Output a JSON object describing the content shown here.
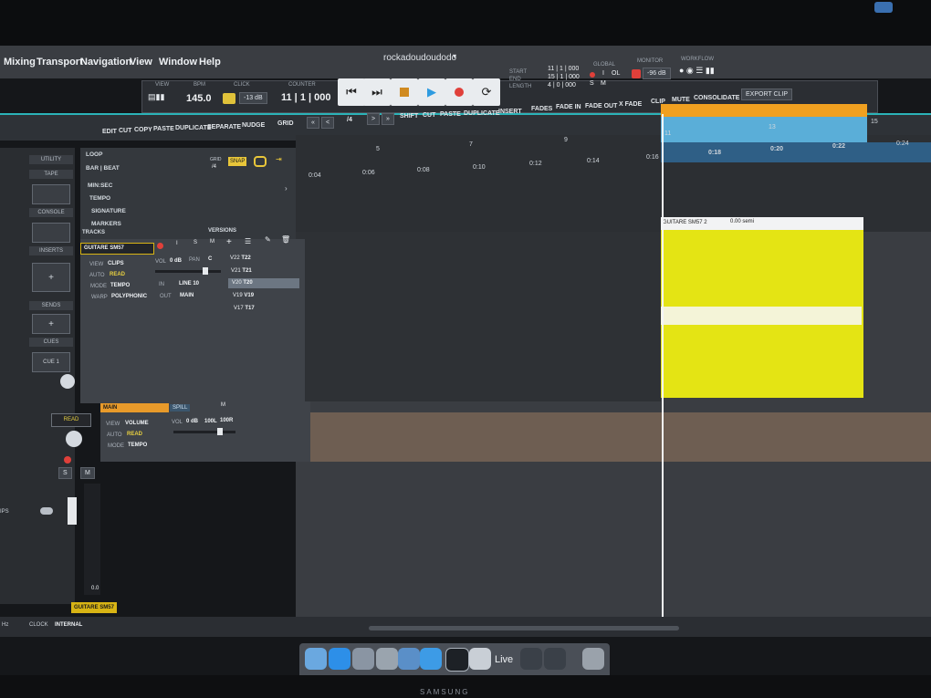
{
  "menu": {
    "items": [
      "Mixing",
      "Transport",
      "Navigation",
      "View",
      "Window",
      "Help"
    ]
  },
  "window": {
    "title": "rockadoudoudodo"
  },
  "transport": {
    "view_label": "VIEW",
    "bpm_label": "BPM",
    "bpm": "145.0",
    "click_label": "CLICK",
    "click_level": "-13 dB",
    "counter_label": "COUNTER",
    "counter": "11 | 1 | 000",
    "start_label": "START",
    "end_label": "END",
    "length_label": "LENGTH",
    "start": "11 | 1 | 000",
    "end": "15 | 1 | 000",
    "length": "4 | 0 | 000",
    "global_label": "GLOBAL",
    "global_i": "I",
    "global_ol": "OL",
    "global_s": "S",
    "global_m": "M",
    "monitor_label": "MONITOR",
    "monitor_level": "-96 dB",
    "workflow_label": "WORKFLOW"
  },
  "toolbar": {
    "edit": "EDIT",
    "cut": "CUT",
    "copy": "COPY",
    "paste": "PASTE",
    "duplicate": "DUPLICATE",
    "separate": "SEPARATE",
    "nudge": "NUDGE",
    "grid": "GRID",
    "grid_value": "/4",
    "shift": "SHIFT",
    "shift_cut": "CUT",
    "shift_paste": "PASTE",
    "shift_duplicate": "DUPLICATE",
    "insert": "INSERT",
    "fades": "FADES",
    "fade_in": "FADE IN",
    "fade_out": "FADE OUT",
    "x_fade": "X FADE",
    "clip": "CLIP",
    "mute": "MUTE",
    "consolidate": "CONSOLIDATE",
    "export_clip": "EXPORT CLIP"
  },
  "sidebar": {
    "utility": "UTILITY",
    "tape": "TAPE",
    "console": "CONSOLE",
    "inserts": "INSERTS",
    "sends": "SENDS",
    "cues": "CUES",
    "cue_value": "CUE 1",
    "read": "READ",
    "s": "S",
    "m": "M",
    "channel_name": "GUITARE SM57",
    "fader_value": "0.0",
    "left_tag": "IPS"
  },
  "rulers": {
    "loop": "LOOP",
    "bar_beat": "BAR | BEAT",
    "min_sec": "MIN:SEC",
    "tempo": "TEMPO",
    "signature": "SIGNATURE",
    "markers": "MARKERS",
    "grid_label": "GRID",
    "grid_value": "/4",
    "snap": "SNAP"
  },
  "timeline": {
    "bars": [
      "5",
      "7",
      "9",
      "11",
      "13",
      "15"
    ],
    "times": [
      "0:04",
      "0:06",
      "0:08",
      "0:10",
      "0:12",
      "0:14",
      "0:16",
      "0:18",
      "0:20",
      "0:22",
      "0:24"
    ]
  },
  "tracks_header": {
    "tracks": "TRACKS",
    "versions": "VERSIONS"
  },
  "track": {
    "name": "GUITARE SM57",
    "view_label": "VIEW",
    "view": "CLIPS",
    "auto_label": "AUTO",
    "auto": "READ",
    "mode_label": "MODE",
    "mode": "TEMPO",
    "warp_label": "WARP",
    "warp": "POLYPHONIC",
    "vol_label": "VOL",
    "vol": "0 dB",
    "pan_label": "PAN",
    "pan": "C",
    "in_label": "IN",
    "in": "LINE 10",
    "out_label": "OUT",
    "out": "MAIN",
    "versions": [
      {
        "v": "V22",
        "t": "T22"
      },
      {
        "v": "V21",
        "t": "T21"
      },
      {
        "v": "V20",
        "t": "T20"
      },
      {
        "v": "V19",
        "t": "V19"
      },
      {
        "v": "V17",
        "t": "T17"
      }
    ]
  },
  "main": {
    "name": "MAIN",
    "spill": "SPILL",
    "m": "M",
    "view_label": "VIEW",
    "view": "VOLUME",
    "auto_label": "AUTO",
    "auto": "READ",
    "mode_label": "MODE",
    "mode": "TEMPO",
    "vol_label": "VOL",
    "vol": "0 dB",
    "l": "100L",
    "r": "100R"
  },
  "clip": {
    "name": "GUITARE SM57",
    "number": "2",
    "pitch": "0.00 semi"
  },
  "statusbar": {
    "hz": "Hz",
    "clock": "CLOCK",
    "internal": "INTERNAL"
  },
  "dock": {
    "live": "Live"
  },
  "brand": "SAMSUNG",
  "colors": {
    "accent": "#2bb3b8",
    "clip": "#e4e414",
    "loop": "#f0a020",
    "timeline_blue": "#5aaed8",
    "record": "#e0403a"
  }
}
